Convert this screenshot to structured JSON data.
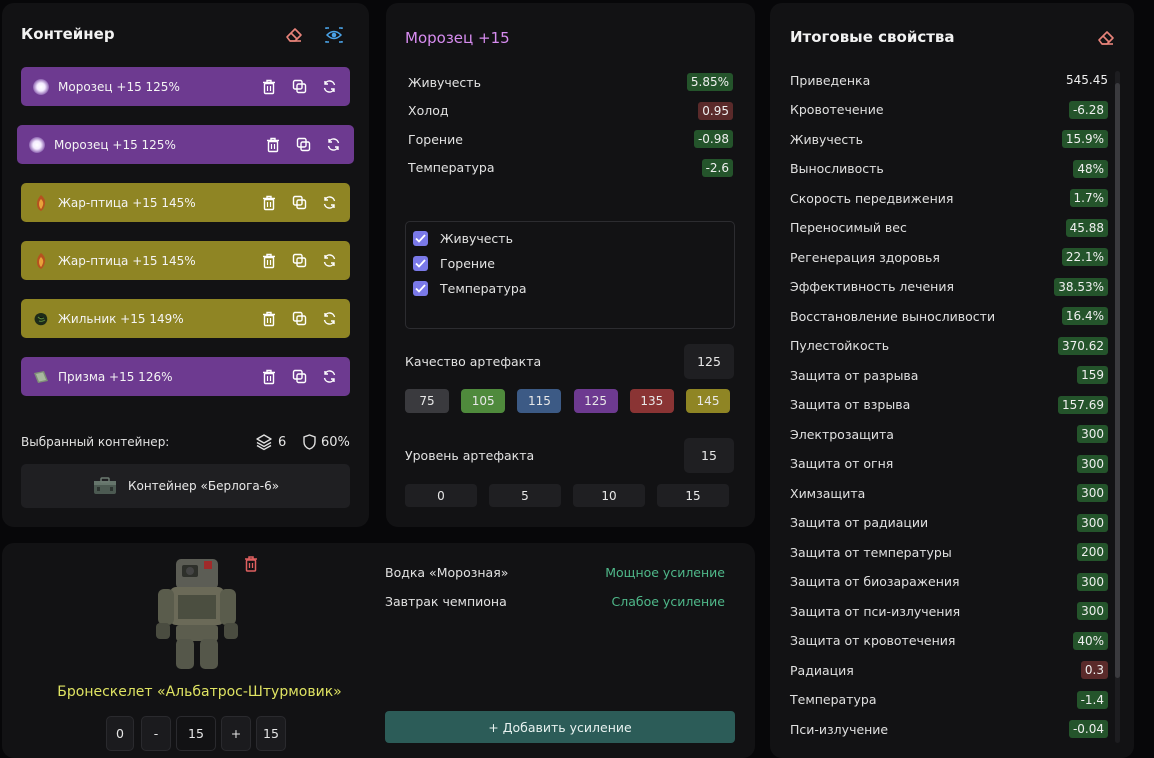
{
  "container": {
    "title": "Контейнер",
    "items": [
      {
        "name": "Морозец +15 125%",
        "color": "purple",
        "icon": "frost-orb-icon"
      },
      {
        "name": "Морозец +15 125%",
        "color": "purple",
        "icon": "frost-orb-icon"
      },
      {
        "name": "Жар-птица +15 145%",
        "color": "gold",
        "icon": "firebird-icon"
      },
      {
        "name": "Жар-птица +15 145%",
        "color": "gold",
        "icon": "firebird-icon"
      },
      {
        "name": "Жильник +15 149%",
        "color": "gold",
        "icon": "vein-stone-icon"
      },
      {
        "name": "Призма +15 126%",
        "color": "purple",
        "icon": "prism-icon"
      }
    ],
    "selected_label": "Выбранный контейнер:",
    "slots": "6",
    "protection": "60%",
    "container_name": "Контейнер «Берлога-6»"
  },
  "artifact": {
    "title": "Морозец +15",
    "stats": [
      {
        "label": "Живучесть",
        "value": "5.85%",
        "tone": "pos"
      },
      {
        "label": "Холод",
        "value": "0.95",
        "tone": "neg"
      },
      {
        "label": "Горение",
        "value": "-0.98",
        "tone": "pos"
      },
      {
        "label": "Температура",
        "value": "-2.6",
        "tone": "pos"
      }
    ],
    "checks": [
      "Живучесть",
      "Горение",
      "Температура"
    ],
    "quality_label": "Качество артефакта",
    "quality_value": "125",
    "quality_presets": [
      {
        "value": "75",
        "color": "#3a3a3e"
      },
      {
        "value": "105",
        "color": "#4f8a3c"
      },
      {
        "value": "115",
        "color": "#3c5a85"
      },
      {
        "value": "125",
        "color": "#6d3a90"
      },
      {
        "value": "135",
        "color": "#8a3434"
      },
      {
        "value": "145",
        "color": "#8f8524"
      }
    ],
    "level_label": "Уровень артефакта",
    "level_value": "15",
    "level_presets": [
      "0",
      "5",
      "10",
      "15"
    ]
  },
  "totals": {
    "title": "Итоговые свойства",
    "rows": [
      {
        "label": "Приведенка",
        "value": "545.45",
        "tone": "plain"
      },
      {
        "label": "Кровотечение",
        "value": "-6.28",
        "tone": "pos"
      },
      {
        "label": "Живучесть",
        "value": "15.9%",
        "tone": "pos"
      },
      {
        "label": "Выносливость",
        "value": "48%",
        "tone": "pos"
      },
      {
        "label": "Скорость передвижения",
        "value": "1.7%",
        "tone": "pos"
      },
      {
        "label": "Переносимый вес",
        "value": "45.88",
        "tone": "pos"
      },
      {
        "label": "Регенерация здоровья",
        "value": "22.1%",
        "tone": "pos"
      },
      {
        "label": "Эффективность лечения",
        "value": "38.53%",
        "tone": "pos"
      },
      {
        "label": "Восстановление выносливости",
        "value": "16.4%",
        "tone": "pos"
      },
      {
        "label": "Пулестойкость",
        "value": "370.62",
        "tone": "pos"
      },
      {
        "label": "Защита от разрыва",
        "value": "159",
        "tone": "pos"
      },
      {
        "label": "Защита от взрыва",
        "value": "157.69",
        "tone": "pos"
      },
      {
        "label": "Электрозащита",
        "value": "300",
        "tone": "pos"
      },
      {
        "label": "Защита от огня",
        "value": "300",
        "tone": "pos"
      },
      {
        "label": "Химзащита",
        "value": "300",
        "tone": "pos"
      },
      {
        "label": "Защита от радиации",
        "value": "300",
        "tone": "pos"
      },
      {
        "label": "Защита от температуры",
        "value": "200",
        "tone": "pos"
      },
      {
        "label": "Защита от биозаражения",
        "value": "300",
        "tone": "pos"
      },
      {
        "label": "Защита от пси-излучения",
        "value": "300",
        "tone": "pos"
      },
      {
        "label": "Защита от кровотечения",
        "value": "40%",
        "tone": "pos"
      },
      {
        "label": "Радиация",
        "value": "0.3",
        "tone": "neg"
      },
      {
        "label": "Температура",
        "value": "-1.4",
        "tone": "pos"
      },
      {
        "label": "Пси-излучение",
        "value": "-0.04",
        "tone": "pos"
      }
    ]
  },
  "armor": {
    "name": "Бронескелет «Альбатрос-Штурмовик»",
    "stepper": {
      "min": "0",
      "dec": "-",
      "value": "15",
      "inc": "+",
      "max": "15"
    },
    "boosts": [
      {
        "label": "Водка «Морозная»",
        "value": "Мощное усиление"
      },
      {
        "label": "Завтрак чемпиона",
        "value": "Слабое усиление"
      }
    ],
    "add_boost": "+ Добавить усиление"
  }
}
